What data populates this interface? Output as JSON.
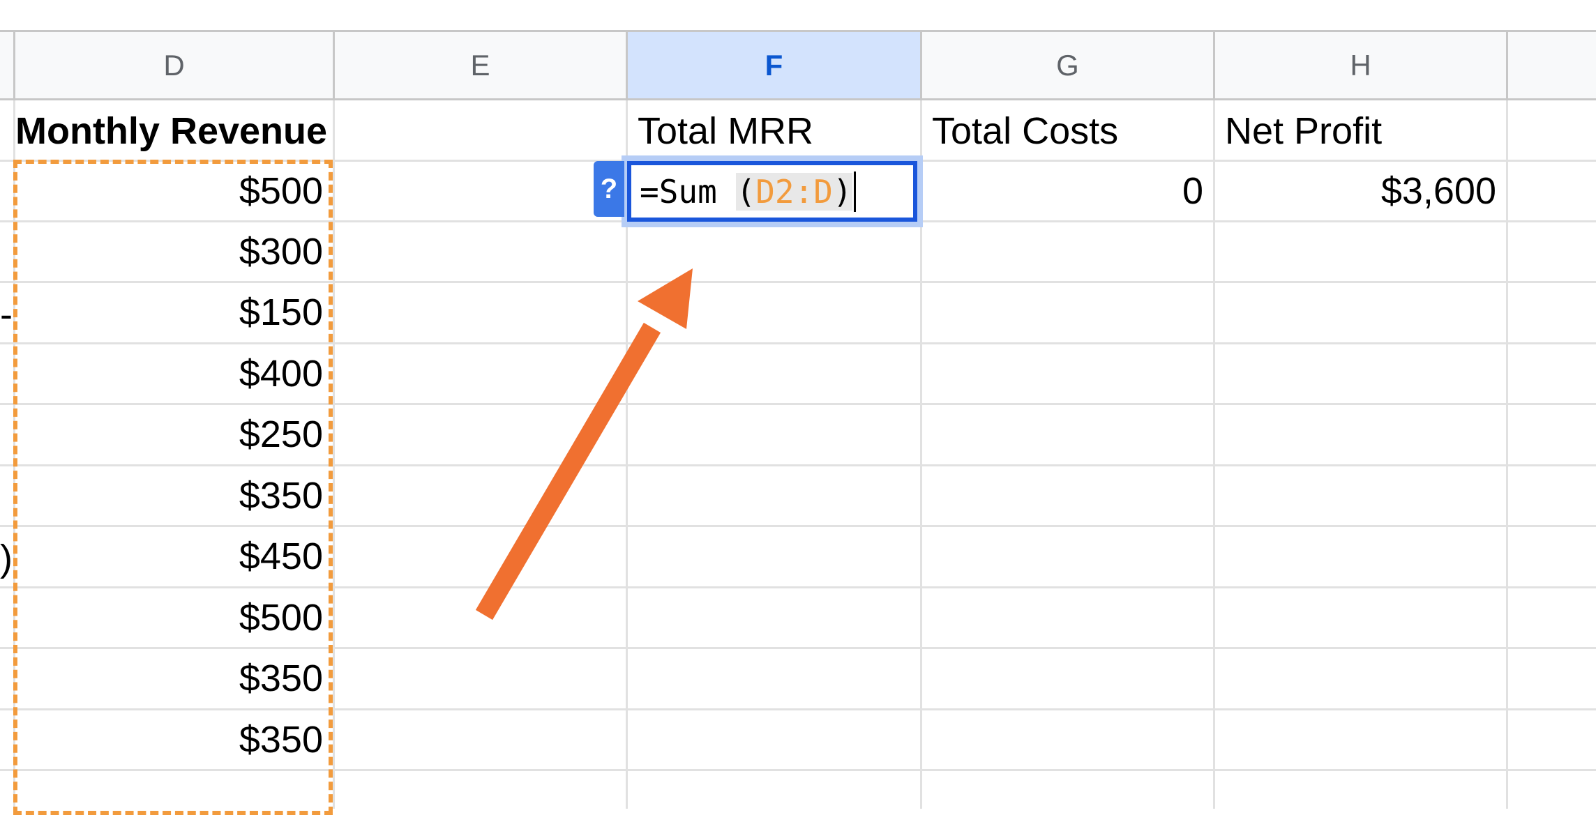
{
  "columns": [
    {
      "letter": "D",
      "selected": false
    },
    {
      "letter": "E",
      "selected": false
    },
    {
      "letter": "F",
      "selected": true
    },
    {
      "letter": "G",
      "selected": false
    },
    {
      "letter": "H",
      "selected": false
    }
  ],
  "headers": {
    "d": "Monthly Revenue",
    "f": "Total MRR",
    "g": "Total Costs",
    "h": "Net Profit"
  },
  "revenue_values": [
    "$500",
    "$300",
    "$150",
    "$400",
    "$250",
    "$350",
    "$450",
    "$500",
    "$350",
    "$350"
  ],
  "row2": {
    "g": "0",
    "h": "$3,600"
  },
  "formula": {
    "prefix": "=Sum ",
    "open_paren": "(",
    "range": "D2:D",
    "close_paren": ")"
  },
  "help_label": "?",
  "left_fragments": {
    "row4": "-",
    "row8": ")"
  },
  "colors": {
    "accent_blue": "#1a56db",
    "selected_header": "#d3e3fd",
    "range_highlight": "#f29b3d",
    "arrow": "#f07030"
  },
  "annotation": {
    "type": "arrow",
    "points_to": "F2"
  }
}
